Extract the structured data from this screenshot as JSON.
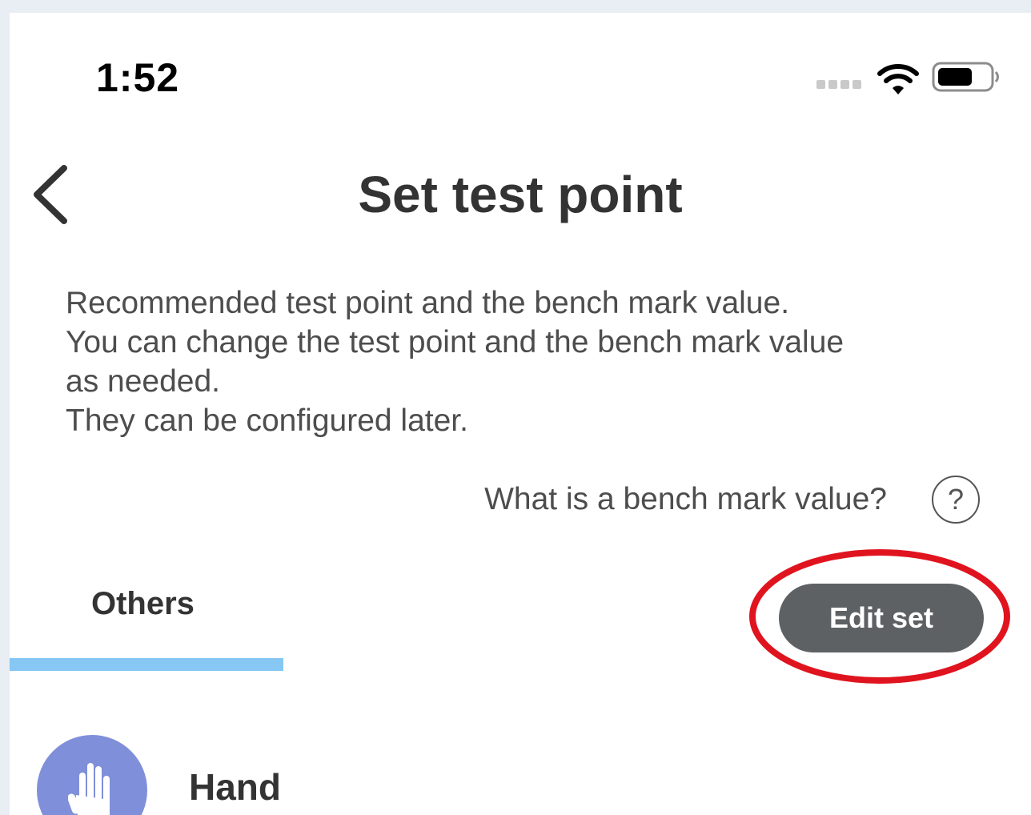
{
  "status_bar": {
    "time": "1:52",
    "icons": [
      "signal-dots",
      "wifi-icon",
      "battery-icon"
    ]
  },
  "header": {
    "title": "Set test point",
    "back_icon": "chevron-left-icon"
  },
  "description": {
    "lines": [
      "Recommended test point and the bench mark value.",
      "You can change the test point and the bench mark value",
      "as needed.",
      "They can be configured later."
    ]
  },
  "help": {
    "text": "What is a bench mark value?",
    "icon_glyph": "?"
  },
  "tabs": [
    {
      "label": "Others",
      "selected": true
    }
  ],
  "edit_button": {
    "label": "Edit set"
  },
  "items": [
    {
      "label": "Hand",
      "icon": "hand-icon"
    }
  ],
  "colors": {
    "tab_indicator": "#86c7f3",
    "button_bg": "#5e6164",
    "annotation_ellipse": "#e0141f",
    "avatar_bg": "#7f8fd9"
  }
}
